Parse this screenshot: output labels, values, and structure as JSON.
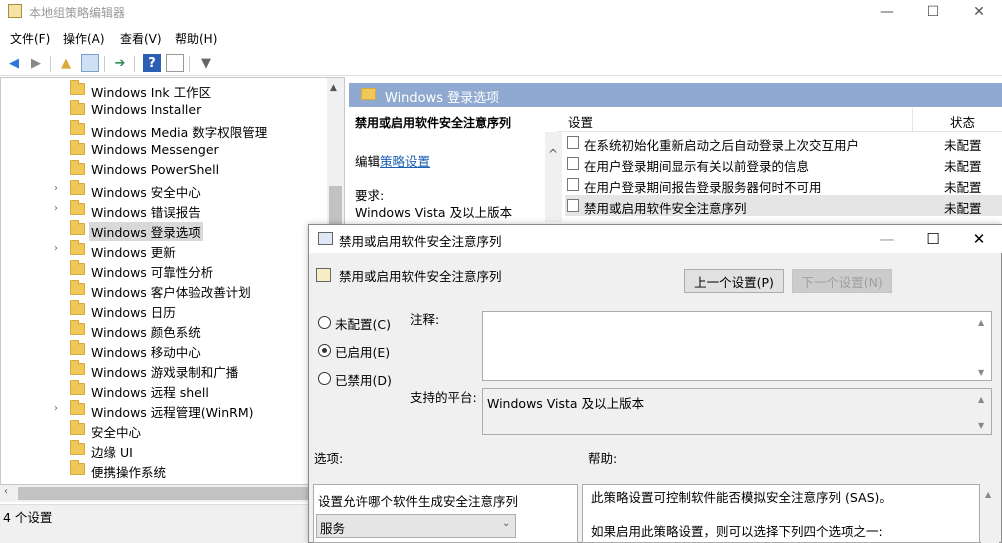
{
  "window": {
    "title": "本地组策略编辑器",
    "min": "—",
    "max": "☐",
    "close": "✕"
  },
  "menu": [
    "文件(F)",
    "操作(A)",
    "查看(V)",
    "帮助(H)"
  ],
  "tree": {
    "items": [
      {
        "label": "Windows Ink 工作区",
        "expand": ""
      },
      {
        "label": "Windows Installer",
        "expand": ""
      },
      {
        "label": "Windows Media 数字权限管理",
        "expand": ""
      },
      {
        "label": "Windows Messenger",
        "expand": ""
      },
      {
        "label": "Windows PowerShell",
        "expand": ""
      },
      {
        "label": "Windows 安全中心",
        "expand": "›"
      },
      {
        "label": "Windows 错误报告",
        "expand": "›"
      },
      {
        "label": "Windows 登录选项",
        "expand": ""
      },
      {
        "label": "Windows 更新",
        "expand": "›"
      },
      {
        "label": "Windows 可靠性分析",
        "expand": ""
      },
      {
        "label": "Windows 客户体验改善计划",
        "expand": ""
      },
      {
        "label": "Windows 日历",
        "expand": ""
      },
      {
        "label": "Windows 颜色系统",
        "expand": ""
      },
      {
        "label": "Windows 移动中心",
        "expand": ""
      },
      {
        "label": "Windows 游戏录制和广播",
        "expand": ""
      },
      {
        "label": "Windows 远程 shell",
        "expand": ""
      },
      {
        "label": "Windows 远程管理(WinRM)",
        "expand": "›"
      },
      {
        "label": "安全中心",
        "expand": ""
      },
      {
        "label": "边缘 UI",
        "expand": ""
      },
      {
        "label": "便携操作系统",
        "expand": ""
      }
    ]
  },
  "status": "4 个设置",
  "right": {
    "header": "Windows 登录选项",
    "desc_title": "禁用或启用软件安全注意序列",
    "edit_prefix": "编辑",
    "edit_link": "策略设置",
    "req_label": "要求:",
    "req_value": "Windows Vista 及以上版本",
    "col_setting": "设置",
    "col_state": "状态",
    "rows": [
      {
        "name": "在系统初始化重新启动之后自动登录上次交互用户",
        "state": "未配置"
      },
      {
        "name": "在用户登录期间显示有关以前登录的信息",
        "state": "未配置"
      },
      {
        "name": "在用户登录期间报告登录服务器何时不可用",
        "state": "未配置"
      },
      {
        "name": "禁用或启用软件安全注意序列",
        "state": "未配置"
      }
    ]
  },
  "dialog": {
    "title": "禁用或启用软件安全注意序列",
    "subtitle": "禁用或启用软件安全注意序列",
    "prev": "上一个设置(P)",
    "next": "下一个设置(N)",
    "radios": [
      "未配置(C)",
      "已启用(E)",
      "已禁用(D)"
    ],
    "selected": "已启用(E)",
    "comment_label": "注释:",
    "platform_label": "支持的平台:",
    "platform_value": "Windows Vista 及以上版本",
    "options_label": "选项:",
    "help_label": "帮助:",
    "option_text": "设置允许哪个软件生成安全注意序列",
    "option_value": "服务",
    "help_line1": "此策略设置可控制软件能否模拟安全注意序列 (SAS)。",
    "help_line2": "如果启用此策略设置，则可以选择下列四个选项之一:"
  }
}
